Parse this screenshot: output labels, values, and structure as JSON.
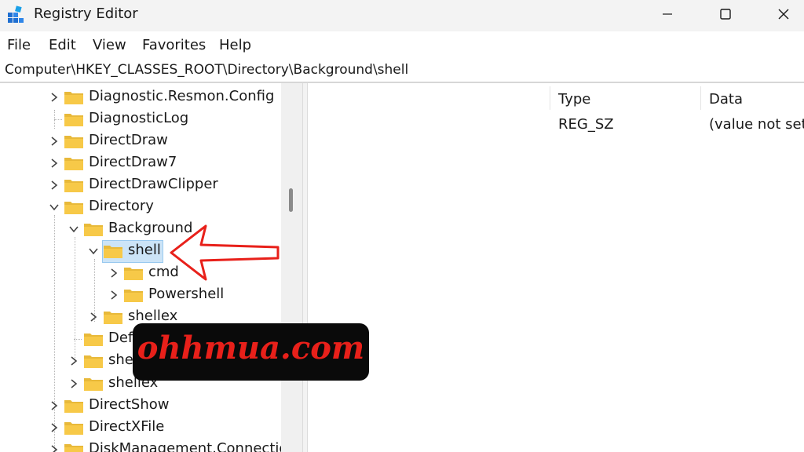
{
  "window": {
    "title": "Registry Editor",
    "minimize_icon": "minimize-icon",
    "maximize_icon": "maximize-icon",
    "close_icon": "close-icon"
  },
  "menu": [
    "File",
    "Edit",
    "View",
    "Favorites",
    "Help"
  ],
  "address": "Computer\\HKEY_CLASSES_ROOT\\Directory\\Background\\shell",
  "tree": [
    {
      "label": "Diagnostic.Resmon.Config",
      "expander": "collapsed"
    },
    {
      "label": "DiagnosticLog",
      "expander": "none"
    },
    {
      "label": "DirectDraw",
      "expander": "collapsed"
    },
    {
      "label": "DirectDraw7",
      "expander": "collapsed"
    },
    {
      "label": "DirectDrawClipper",
      "expander": "collapsed"
    },
    {
      "label": "Directory",
      "expander": "expanded"
    },
    {
      "label": "Background",
      "expander": "expanded"
    },
    {
      "label": "shell",
      "expander": "expanded",
      "selected": true
    },
    {
      "label": "cmd",
      "expander": "collapsed"
    },
    {
      "label": "Powershell",
      "expander": "collapsed"
    },
    {
      "label": "shellex",
      "expander": "collapsed"
    },
    {
      "label": "Def",
      "expander": "none"
    },
    {
      "label": "she",
      "expander": "collapsed"
    },
    {
      "label": "shellex",
      "expander": "collapsed"
    },
    {
      "label": "DirectShow",
      "expander": "collapsed"
    },
    {
      "label": "DirectXFile",
      "expander": "collapsed"
    },
    {
      "label": "DiskManagement.Connectior",
      "expander": "collapsed"
    }
  ],
  "values_table": {
    "headers": {
      "type": "Type",
      "data": "Data"
    },
    "rows": [
      {
        "type": "REG_SZ",
        "data": "(value not set)"
      }
    ]
  },
  "watermark": "ohhmua.com",
  "colors": {
    "selection": "#cce4f7",
    "folder": "#f7c948",
    "annotation": "#e8201a"
  }
}
